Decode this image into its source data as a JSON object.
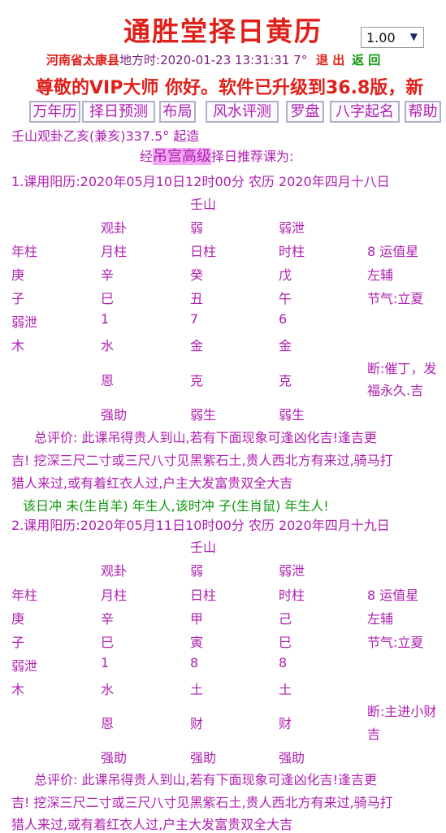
{
  "header": {
    "title": "通胜堂择日黄历",
    "zoom_value": "1.00",
    "place": "河南省太康县",
    "time_label": "地方时:2020-01-23 13:31:31 7°",
    "logout_label": "退 出",
    "back_label": "返 回",
    "marquee": "尊敬的VIP大师 你好。软件已升级到36.8版，新"
  },
  "nav": {
    "items": [
      "万年历",
      "择日预测",
      "布局",
      "风水评测",
      "罗盘",
      "八字起名",
      "帮助"
    ]
  },
  "intro": {
    "mountain_line": "壬山观卦乙亥(兼亥)337.5° 起造",
    "recommend_prefix": "经",
    "recommend_highlight": "吊宫高级",
    "recommend_suffix": "择日推荐课为:"
  },
  "results": [
    {
      "header": "1.课用阳历:2020年05月10日12时00分 农历 2020年四月十八日",
      "mountain": "壬山",
      "hexagram": "观卦",
      "day_strength": "弱",
      "hour_note": "弱泄",
      "col_labels": [
        "年柱",
        "月柱",
        "日柱",
        "时柱",
        "8 运值星"
      ],
      "stems": [
        "庚",
        "辛",
        "癸",
        "戊",
        "左辅"
      ],
      "branches": [
        "子",
        "巳",
        "丑",
        "午",
        "节气:立夏"
      ],
      "numbers": [
        "弱泄",
        "1",
        "7",
        "6"
      ],
      "elements": [
        "木",
        "水",
        "金",
        "金"
      ],
      "relations": [
        "恩",
        "克",
        "克"
      ],
      "judgement_line1": "断:催丁，发",
      "judgement_line2": "福永久.吉",
      "supports": [
        "强助",
        "弱生",
        "弱生"
      ],
      "summary_line1": "总评价:   此课吊得贵人到山,若有下面现象可逢凶化吉!逢吉更",
      "summary_line2": "吉!  挖深三尺二寸或三尺八寸见黑紫石土,贵人西北方有来过,骑马打",
      "summary_line3": "猎人来过,或有着红衣人过,户主大发富贵双全大吉",
      "clash": "该日冲 未(生肖羊) 年生人,该时冲 子(生肖鼠) 年生人!"
    },
    {
      "header": "2.课用阳历:2020年05月11日10时00分 农历 2020年四月十九日",
      "mountain": "壬山",
      "hexagram": "观卦",
      "day_strength": "弱",
      "hour_note": "弱泄",
      "col_labels": [
        "年柱",
        "月柱",
        "日柱",
        "时柱",
        "8 运值星"
      ],
      "stems": [
        "庚",
        "辛",
        "甲",
        "己",
        "左辅"
      ],
      "branches": [
        "子",
        "巳",
        "寅",
        "巳",
        "节气:立夏"
      ],
      "numbers": [
        "弱泄",
        "1",
        "8",
        "8"
      ],
      "elements": [
        "木",
        "水",
        "土",
        "土"
      ],
      "relations": [
        "恩",
        "财",
        "财"
      ],
      "judgement_line1": "断:主进小财",
      "judgement_line2": "吉",
      "supports": [
        "强助",
        "强助",
        "强助"
      ],
      "summary_line1": "总评价:   此课吊得贵人到山,若有下面现象可逢凶化吉!逢吉更",
      "summary_line2": "吉!  挖深三尺二寸或三尺八寸见黑紫石土,贵人西北方有来过,骑马打",
      "summary_line3": "猎人来过,或有着红衣人过,户主大发富贵双全大吉"
    }
  ],
  "colors": {
    "title_red": "#e0201a",
    "text_purple": "#b020b0",
    "back_green": "#119911",
    "highlight_pink": "#f4a8f4"
  }
}
